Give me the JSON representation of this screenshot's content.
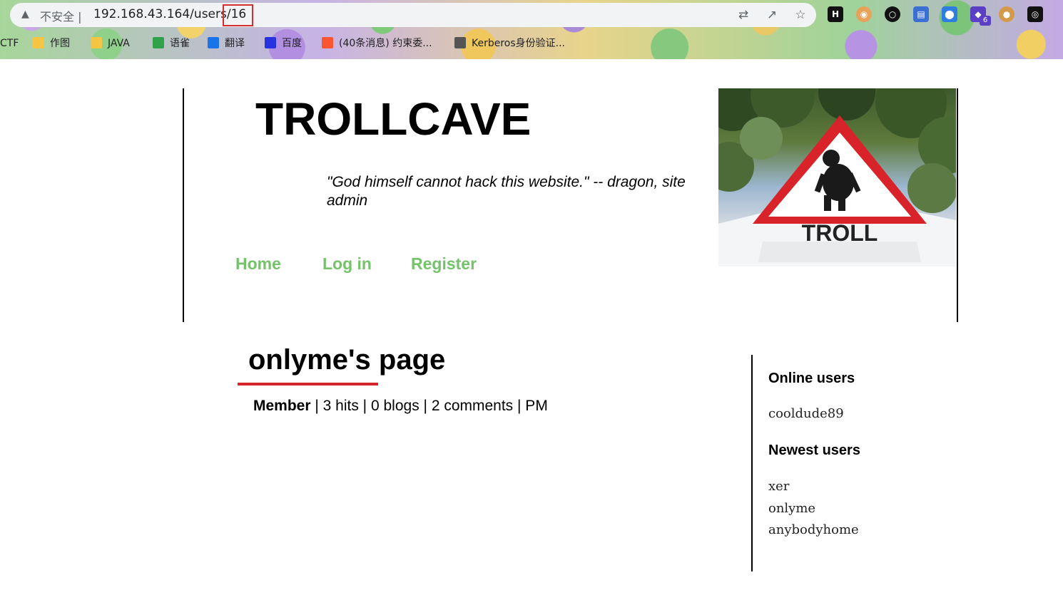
{
  "browser": {
    "insecure_label": "不安全",
    "url_prefix": "192.168.43.164/users/",
    "url_id": "16",
    "extension_badge": "6",
    "bookmarks": [
      {
        "label": "CTF",
        "color": "#f4b400"
      },
      {
        "label": "作图",
        "color": "#f4c542"
      },
      {
        "label": "JAVA",
        "color": "#f4c542"
      },
      {
        "label": "语雀",
        "color": "#31a24c"
      },
      {
        "label": "翻译",
        "color": "#1a73e8"
      },
      {
        "label": "百度",
        "color": "#2932e1"
      },
      {
        "label": "(40条消息) 约束委...",
        "color": "#fc5531"
      },
      {
        "label": "Kerberos身份验证...",
        "color": "#555555"
      }
    ]
  },
  "site": {
    "title": "TROLLCAVE",
    "tagline": "\"God himself cannot hack this website.\" -- dragon, site admin",
    "nav": {
      "home": "Home",
      "login": "Log in",
      "register": "Register"
    },
    "hero_sign_text": "TROLL"
  },
  "profile": {
    "title": "onlyme's page",
    "role": "Member",
    "stats": " | 3 hits | 0 blogs | 2 comments | PM"
  },
  "sidebar": {
    "online_heading": "Online users",
    "online_users": [
      "cooldude89"
    ],
    "newest_heading": "Newest users",
    "newest_users": [
      "xer",
      "onlyme",
      "anybodyhome"
    ]
  },
  "colors": {
    "nav_link": "#74c26a",
    "title_underline": "#d8232a",
    "url_highlight_box": "#d32f2f"
  }
}
